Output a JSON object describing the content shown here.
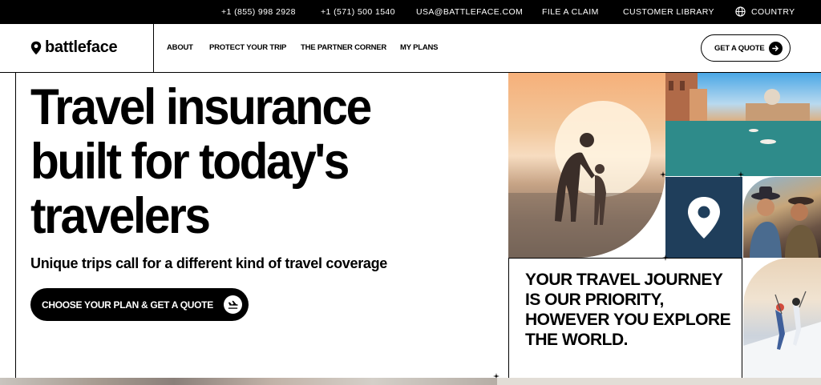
{
  "topbar": {
    "phone1": "+1 (855) 998 2928",
    "phone2": "+1 (571) 500 1540",
    "email": "USA@BATTLEFACE.COM",
    "claim": "FILE A CLAIM",
    "library": "CUSTOMER LIBRARY",
    "country": "COUNTRY"
  },
  "nav": {
    "logo": "battleface",
    "links": [
      "ABOUT",
      "PROTECT YOUR TRIP",
      "THE PARTNER CORNER",
      "MY PLANS"
    ],
    "quote": "GET A QUOTE"
  },
  "hero": {
    "title": "Travel insurance built for today's travelers",
    "subtitle": "Unique trips call for a different kind of travel coverage",
    "cta": "CHOOSE YOUR PLAN & GET A QUOTE"
  },
  "panel": {
    "priority": "YOUR TRAVEL JOURNEY IS OUR PRIORITY, HOWEVER YOU EXPLORE THE WORLD."
  },
  "colors": {
    "pin_tile": "#1f3e5b",
    "black": "#000000"
  },
  "icons": {
    "globe": "globe-icon",
    "logo_pin": "location-pin-icon",
    "quote_arrow": "arrow-right-icon",
    "cta_icon": "plane-landing-icon",
    "tile_pin": "location-pin-icon"
  }
}
